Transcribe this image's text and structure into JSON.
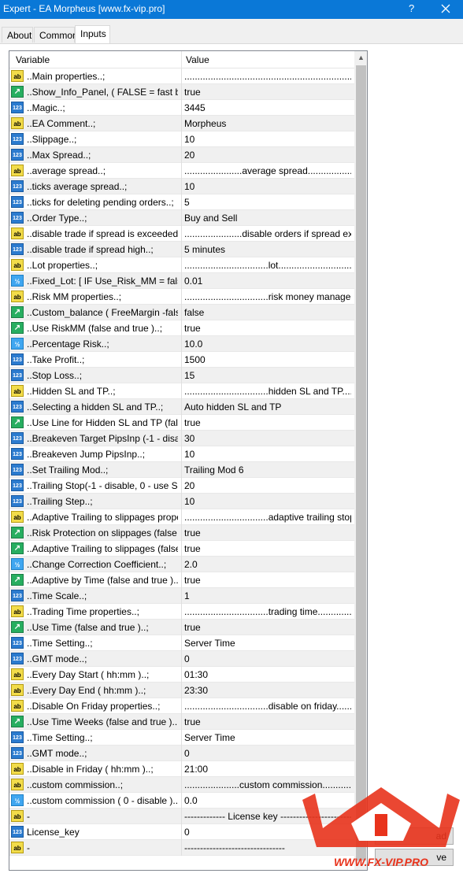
{
  "window": {
    "title": "Expert - EA Morpheus [www.fx-vip.pro]",
    "help": "?"
  },
  "tabs": [
    {
      "label": "About"
    },
    {
      "label": "Common"
    },
    {
      "label": "Inputs"
    }
  ],
  "grid": {
    "header": {
      "variable": "Variable",
      "value": "Value"
    },
    "rows": [
      {
        "icon": "ab",
        "name": "..Main properties..;",
        "value": "........................................................................"
      },
      {
        "icon": "bool",
        "name": "..Show_Info_Panel, ( FALSE = fast ba...",
        "value": "true"
      },
      {
        "icon": "123",
        "name": "..Magic..;",
        "value": "3445"
      },
      {
        "icon": "ab",
        "name": "..EA Comment..;",
        "value": "Morpheus"
      },
      {
        "icon": "123",
        "name": "..Slippage..;",
        "value": "10"
      },
      {
        "icon": "123",
        "name": "..Max Spread..;",
        "value": "20"
      },
      {
        "icon": "ab",
        "name": "..average spread..;",
        "value": "......................average spread......................"
      },
      {
        "icon": "123",
        "name": "..ticks average spread..;",
        "value": "10"
      },
      {
        "icon": "123",
        "name": "..ticks for deleting pending orders..;",
        "value": "5"
      },
      {
        "icon": "123",
        "name": "..Order Type..;",
        "value": "Buy and Sell"
      },
      {
        "icon": "ab",
        "name": "..disable trade if spread is exceeded..;",
        "value": "......................disable orders if spread exce..."
      },
      {
        "icon": "123",
        "name": "..disable trade if spread high..;",
        "value": "5 minutes"
      },
      {
        "icon": "ab",
        "name": "..Lot properties..;",
        "value": "................................lot................................"
      },
      {
        "icon": "v2",
        "name": "..Fixed_Lot: [ IF  Use_Risk_MM = false...",
        "value": "0.01"
      },
      {
        "icon": "ab",
        "name": "..Risk MM properties..;",
        "value": "................................risk money managemen..."
      },
      {
        "icon": "bool",
        "name": "..Custom_balance ( FreeMargin -false ...",
        "value": "false"
      },
      {
        "icon": "bool",
        "name": "..Use RiskMM (false and true )..;",
        "value": "true"
      },
      {
        "icon": "v2",
        "name": "..Percentage Risk..;",
        "value": "10.0"
      },
      {
        "icon": "123",
        "name": "..Take Profit..;",
        "value": "1500"
      },
      {
        "icon": "123",
        "name": "..Stop Loss..;",
        "value": "15"
      },
      {
        "icon": "ab",
        "name": "..Hidden SL and TP..;",
        "value": "................................hidden SL and TP.............."
      },
      {
        "icon": "123",
        "name": "..Selecting a hidden SL and TP..;",
        "value": "Auto hidden SL and TP"
      },
      {
        "icon": "bool",
        "name": "..Use Line for Hidden SL and TP (fals...",
        "value": "true"
      },
      {
        "icon": "123",
        "name": "..Breakeven Target PipsInp (-1 - disabl...",
        "value": "30"
      },
      {
        "icon": "123",
        "name": "..Breakeven Jump PipsInp..;",
        "value": "10"
      },
      {
        "icon": "123",
        "name": "..Set Trailing Mod..;",
        "value": "Trailing Mod 6"
      },
      {
        "icon": "123",
        "name": "..Trailing Stop(-1 - disable, 0 - use SL)..;",
        "value": "20"
      },
      {
        "icon": "123",
        "name": "..Trailing Step..;",
        "value": "10"
      },
      {
        "icon": "ab",
        "name": "..Adaptive Trailing to slippages properti...",
        "value": "................................adaptive trailing stop.........."
      },
      {
        "icon": "bool",
        "name": "..Risk Protection on slippages (false a...",
        "value": "true"
      },
      {
        "icon": "bool",
        "name": "..Adaptive Trailing to slippages (false a...",
        "value": "true"
      },
      {
        "icon": "v2",
        "name": "..Change Correction Coefficient..;",
        "value": "2.0"
      },
      {
        "icon": "bool",
        "name": "..Adaptive by Time (false and true )..;",
        "value": "true"
      },
      {
        "icon": "123",
        "name": "..Time Scale..;",
        "value": "1"
      },
      {
        "icon": "ab",
        "name": "..Trading Time properties..;",
        "value": "................................trading time......................."
      },
      {
        "icon": "bool",
        "name": "..Use Time (false and true )..;",
        "value": "true"
      },
      {
        "icon": "123",
        "name": "..Time Setting..;",
        "value": "Server Time"
      },
      {
        "icon": "123",
        "name": "..GMT mode..;",
        "value": "0"
      },
      {
        "icon": "ab",
        "name": "..Every Day Start ( hh:mm )..;",
        "value": "01:30"
      },
      {
        "icon": "ab",
        "name": "..Every Day End ( hh:mm )..;",
        "value": "23:30"
      },
      {
        "icon": "ab",
        "name": "..Disable On Friday properties..;",
        "value": "................................disable on friday..............."
      },
      {
        "icon": "bool",
        "name": "..Use Time Weeks (false and true )..;",
        "value": "true"
      },
      {
        "icon": "123",
        "name": "..Time Setting..;",
        "value": "Server Time"
      },
      {
        "icon": "123",
        "name": "..GMT mode..;",
        "value": "0"
      },
      {
        "icon": "ab",
        "name": "..Disable in Friday ( hh:mm )..;",
        "value": "21:00"
      },
      {
        "icon": "ab",
        "name": "..custom commission..;",
        "value": ".....................custom commission...................."
      },
      {
        "icon": "v2",
        "name": "..custom commission ( 0 - disable )..;",
        "value": "0.0"
      },
      {
        "icon": "ab",
        "name": "-",
        "value": "------------- License key -----------------------------"
      },
      {
        "icon": "123",
        "name": "License_key",
        "value": "0"
      },
      {
        "icon": "ab",
        "name": "-",
        "value": "--------------------------------"
      }
    ]
  },
  "side_buttons": [
    {
      "label": "ad"
    },
    {
      "label": "ve"
    }
  ],
  "watermark": {
    "text": "WWW.FX-VIP.PRO",
    "brand_color": "#e8331c"
  },
  "colors": {
    "titlebar": "#0a78d7",
    "ab_icon": "#f2dc4a",
    "num_icon": "#2b7bcf",
    "bool_icon": "#27ae60"
  }
}
